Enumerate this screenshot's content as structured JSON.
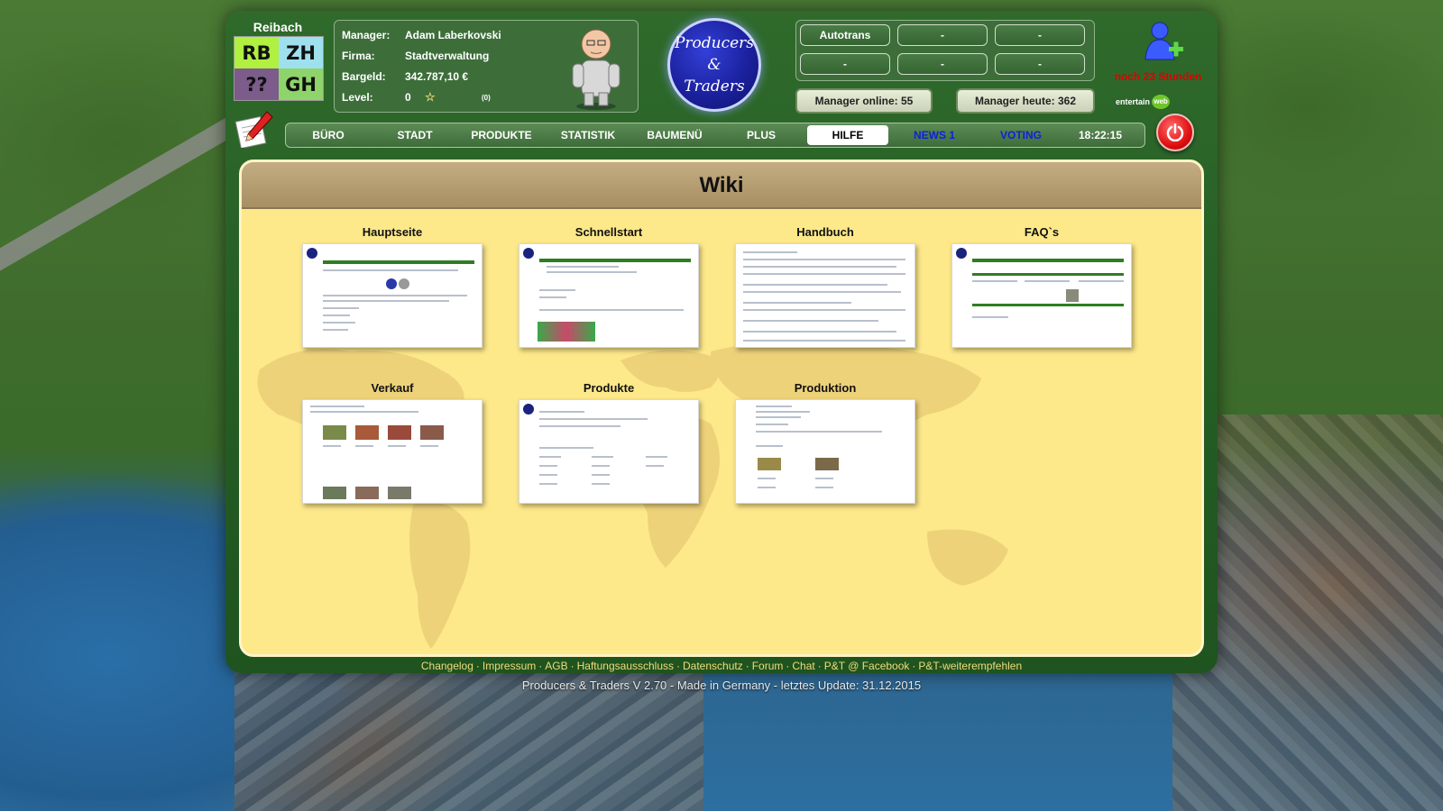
{
  "header": {
    "town_name": "Reibach",
    "town_logo": [
      "RB",
      "ZH",
      "??",
      "GH"
    ],
    "manager_label": "Manager:",
    "manager": "Adam Laberkovski",
    "company_label": "Firma:",
    "company": "Stadtverwaltung",
    "cash_label": "Bargeld:",
    "cash": "342.787,10 €",
    "level_label": "Level:",
    "level": "0",
    "level_sub": "(0)",
    "brand_line1": "Producers",
    "brand_line2": "&",
    "brand_line3": "Traders",
    "quick_buttons": [
      "Autotrans",
      "-",
      "-",
      "-",
      "-",
      "-"
    ],
    "online_label": "Manager online:",
    "online_count": "55",
    "today_label": "Manager heute:",
    "today_count": "362",
    "next_time": "noch 23 Stunden",
    "entertain_text": "entertain",
    "entertain_web": "web"
  },
  "nav": {
    "items": [
      "BÜRO",
      "STADT",
      "PRODUKTE",
      "STATISTIK",
      "BAUMENÜ",
      "PLUS",
      "HILFE",
      "NEWS 1",
      "VOTING",
      "18:22:15"
    ],
    "active": "HILFE"
  },
  "panel": {
    "title": "Wiki",
    "cards": [
      "Hauptseite",
      "Schnellstart",
      "Handbuch",
      "FAQ`s",
      "Verkauf",
      "Produkte",
      "Produktion"
    ]
  },
  "footer": {
    "links": [
      "Changelog",
      "Impressum",
      "AGB",
      "Haftungsausschluss",
      "Datenschutz",
      "Forum",
      "Chat",
      "P&T @ Facebook",
      "P&T-weiterempfehlen"
    ],
    "separator": "·",
    "version": "Producers & Traders V 2.70 - Made in Germany - letztes Update: 31.12.2015"
  },
  "colors": {
    "panel_bg": "#fde88a",
    "nav_active_bg": "#ffffff",
    "news_link": "#0b22d8",
    "alert_red": "#e00000"
  }
}
